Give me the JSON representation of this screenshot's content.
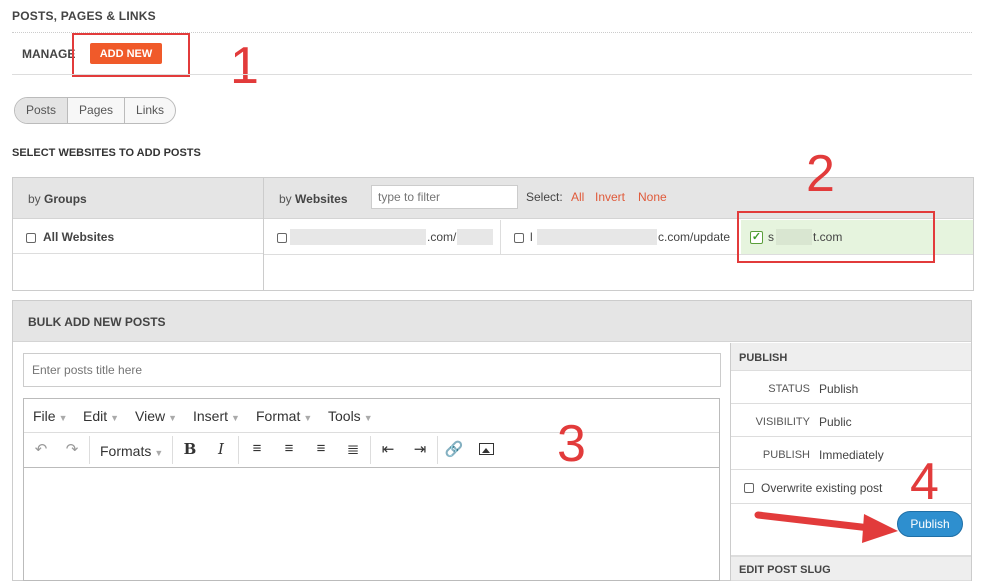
{
  "header": {
    "section_title": "POSTS, PAGES & LINKS",
    "manage_label": "MANAGE",
    "add_new_label": "ADD NEW"
  },
  "annotations": [
    "1",
    "2",
    "3",
    "4"
  ],
  "type_tabs": [
    {
      "label": "Posts",
      "active": true
    },
    {
      "label": "Pages",
      "active": false
    },
    {
      "label": "Links",
      "active": false
    }
  ],
  "select_sites": {
    "title": "SELECT WEBSITES TO ADD POSTS",
    "by_prefix": "by",
    "groups_label": "Groups",
    "websites_label": "Websites",
    "filter_placeholder": "type to filter",
    "select_label": "Select:",
    "links": [
      "All",
      "Invert",
      "None"
    ],
    "all_websites_label": "All Websites",
    "sites": [
      {
        "label": ".com/b",
        "checked": false
      },
      {
        "label": "c.com/update",
        "checked": false,
        "prefix": "l"
      },
      {
        "label": "t.com",
        "checked": true,
        "prefix": "s"
      }
    ]
  },
  "bulk": {
    "title": "BULK ADD NEW POSTS",
    "title_placeholder": "Enter posts title here",
    "menu": [
      "File",
      "Edit",
      "View",
      "Insert",
      "Format",
      "Tools"
    ],
    "formats_label": "Formats"
  },
  "publish": {
    "title": "PUBLISH",
    "status_key": "STATUS",
    "status_val": "Publish",
    "visibility_key": "VISIBILITY",
    "visibility_val": "Public",
    "publish_key": "PUBLISH",
    "publish_val": "Immediately",
    "overwrite_label": "Overwrite existing post",
    "publish_button": "Publish",
    "slug_title": "EDIT POST SLUG"
  },
  "colors": {
    "accent": "#f05a2a",
    "annotation": "#e23b3b",
    "link": "#e05a3a",
    "publish_btn": "#2e8fcf",
    "selected_bg": "#e6f4de"
  }
}
